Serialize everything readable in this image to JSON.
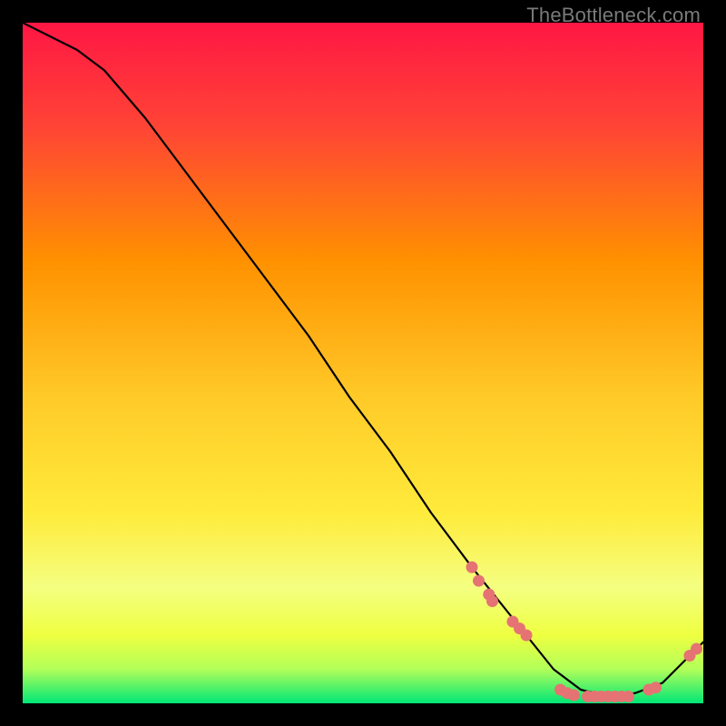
{
  "watermark": "TheBottleneck.com",
  "chart_data": {
    "type": "line",
    "title": "",
    "xlabel": "",
    "ylabel": "",
    "xlim": [
      0,
      100
    ],
    "ylim": [
      0,
      100
    ],
    "grid": false,
    "legend": false,
    "background_gradient": {
      "top": "#ff1744",
      "upper_mid": "#ff9100",
      "mid": "#ffeb3b",
      "lower_mid": "#eeff41",
      "bottom": "#00e676"
    },
    "series": [
      {
        "name": "curve",
        "type": "line",
        "color": "#000000",
        "x": [
          0,
          4,
          8,
          12,
          18,
          24,
          30,
          36,
          42,
          48,
          54,
          60,
          66,
          70,
          74,
          78,
          82,
          86,
          90,
          94,
          100
        ],
        "y": [
          100,
          98,
          96,
          93,
          86,
          78,
          70,
          62,
          54,
          45,
          37,
          28,
          20,
          15,
          10,
          5,
          2,
          1,
          1.5,
          3,
          9
        ]
      },
      {
        "name": "markers",
        "type": "scatter",
        "color": "#e57373",
        "x": [
          66,
          67,
          68.5,
          69,
          72,
          73,
          74,
          79,
          80,
          81,
          83,
          84,
          85,
          86,
          87,
          88,
          89,
          92,
          93,
          98,
          99
        ],
        "y": [
          20,
          18,
          16,
          15,
          12,
          11,
          10,
          2,
          1.5,
          1.2,
          1,
          1,
          1,
          1,
          1,
          1,
          1,
          2,
          2.3,
          7,
          8
        ]
      }
    ]
  }
}
